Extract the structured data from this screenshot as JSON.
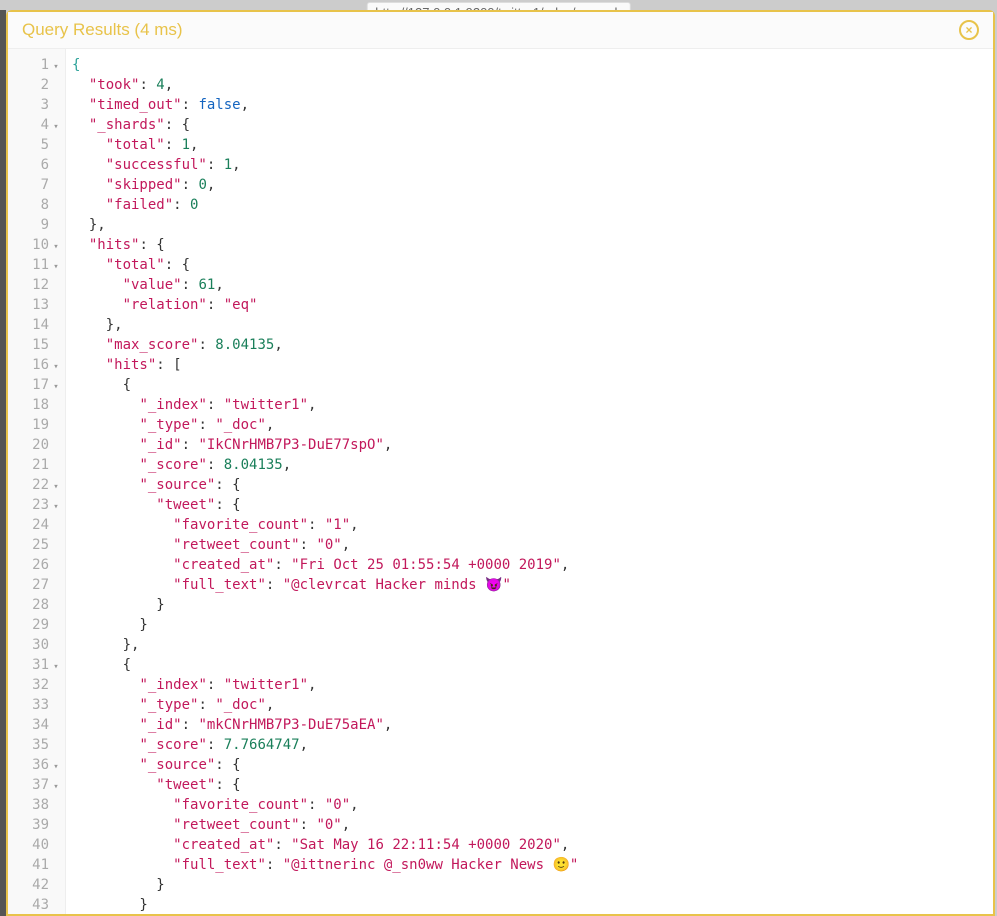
{
  "header": {
    "title": "Query Results (4 ms)",
    "close_label": "×",
    "background_url": "http://127.0.0.1:9200/twitter1/_doc/_search"
  },
  "code_lines": [
    {
      "num": 1,
      "fold": "▾",
      "tokens": [
        {
          "t": "{",
          "c": "br-open"
        }
      ]
    },
    {
      "num": 2,
      "fold": "",
      "tokens": [
        {
          "t": "  ",
          "c": "p"
        },
        {
          "t": "\"took\"",
          "c": "k"
        },
        {
          "t": ": ",
          "c": "p"
        },
        {
          "t": "4",
          "c": "n"
        },
        {
          "t": ",",
          "c": "p"
        }
      ]
    },
    {
      "num": 3,
      "fold": "",
      "tokens": [
        {
          "t": "  ",
          "c": "p"
        },
        {
          "t": "\"timed_out\"",
          "c": "k"
        },
        {
          "t": ": ",
          "c": "p"
        },
        {
          "t": "false",
          "c": "b"
        },
        {
          "t": ",",
          "c": "p"
        }
      ]
    },
    {
      "num": 4,
      "fold": "▾",
      "tokens": [
        {
          "t": "  ",
          "c": "p"
        },
        {
          "t": "\"_shards\"",
          "c": "k"
        },
        {
          "t": ": {",
          "c": "p"
        }
      ]
    },
    {
      "num": 5,
      "fold": "",
      "tokens": [
        {
          "t": "    ",
          "c": "p"
        },
        {
          "t": "\"total\"",
          "c": "k"
        },
        {
          "t": ": ",
          "c": "p"
        },
        {
          "t": "1",
          "c": "n"
        },
        {
          "t": ",",
          "c": "p"
        }
      ]
    },
    {
      "num": 6,
      "fold": "",
      "tokens": [
        {
          "t": "    ",
          "c": "p"
        },
        {
          "t": "\"successful\"",
          "c": "k"
        },
        {
          "t": ": ",
          "c": "p"
        },
        {
          "t": "1",
          "c": "n"
        },
        {
          "t": ",",
          "c": "p"
        }
      ]
    },
    {
      "num": 7,
      "fold": "",
      "tokens": [
        {
          "t": "    ",
          "c": "p"
        },
        {
          "t": "\"skipped\"",
          "c": "k"
        },
        {
          "t": ": ",
          "c": "p"
        },
        {
          "t": "0",
          "c": "n"
        },
        {
          "t": ",",
          "c": "p"
        }
      ]
    },
    {
      "num": 8,
      "fold": "",
      "tokens": [
        {
          "t": "    ",
          "c": "p"
        },
        {
          "t": "\"failed\"",
          "c": "k"
        },
        {
          "t": ": ",
          "c": "p"
        },
        {
          "t": "0",
          "c": "n"
        }
      ]
    },
    {
      "num": 9,
      "fold": "",
      "tokens": [
        {
          "t": "  },",
          "c": "p"
        }
      ]
    },
    {
      "num": 10,
      "fold": "▾",
      "tokens": [
        {
          "t": "  ",
          "c": "p"
        },
        {
          "t": "\"hits\"",
          "c": "k"
        },
        {
          "t": ": {",
          "c": "p"
        }
      ]
    },
    {
      "num": 11,
      "fold": "▾",
      "tokens": [
        {
          "t": "    ",
          "c": "p"
        },
        {
          "t": "\"total\"",
          "c": "k"
        },
        {
          "t": ": {",
          "c": "p"
        }
      ]
    },
    {
      "num": 12,
      "fold": "",
      "tokens": [
        {
          "t": "      ",
          "c": "p"
        },
        {
          "t": "\"value\"",
          "c": "k"
        },
        {
          "t": ": ",
          "c": "p"
        },
        {
          "t": "61",
          "c": "n"
        },
        {
          "t": ",",
          "c": "p"
        }
      ]
    },
    {
      "num": 13,
      "fold": "",
      "tokens": [
        {
          "t": "      ",
          "c": "p"
        },
        {
          "t": "\"relation\"",
          "c": "k"
        },
        {
          "t": ": ",
          "c": "p"
        },
        {
          "t": "\"eq\"",
          "c": "s"
        }
      ]
    },
    {
      "num": 14,
      "fold": "",
      "tokens": [
        {
          "t": "    },",
          "c": "p"
        }
      ]
    },
    {
      "num": 15,
      "fold": "",
      "tokens": [
        {
          "t": "    ",
          "c": "p"
        },
        {
          "t": "\"max_score\"",
          "c": "k"
        },
        {
          "t": ": ",
          "c": "p"
        },
        {
          "t": "8.04135",
          "c": "n"
        },
        {
          "t": ",",
          "c": "p"
        }
      ]
    },
    {
      "num": 16,
      "fold": "▾",
      "tokens": [
        {
          "t": "    ",
          "c": "p"
        },
        {
          "t": "\"hits\"",
          "c": "k"
        },
        {
          "t": ": [",
          "c": "p"
        }
      ]
    },
    {
      "num": 17,
      "fold": "▾",
      "tokens": [
        {
          "t": "      {",
          "c": "p"
        }
      ]
    },
    {
      "num": 18,
      "fold": "",
      "tokens": [
        {
          "t": "        ",
          "c": "p"
        },
        {
          "t": "\"_index\"",
          "c": "k"
        },
        {
          "t": ": ",
          "c": "p"
        },
        {
          "t": "\"twitter1\"",
          "c": "s"
        },
        {
          "t": ",",
          "c": "p"
        }
      ]
    },
    {
      "num": 19,
      "fold": "",
      "tokens": [
        {
          "t": "        ",
          "c": "p"
        },
        {
          "t": "\"_type\"",
          "c": "k"
        },
        {
          "t": ": ",
          "c": "p"
        },
        {
          "t": "\"_doc\"",
          "c": "s"
        },
        {
          "t": ",",
          "c": "p"
        }
      ]
    },
    {
      "num": 20,
      "fold": "",
      "tokens": [
        {
          "t": "        ",
          "c": "p"
        },
        {
          "t": "\"_id\"",
          "c": "k"
        },
        {
          "t": ": ",
          "c": "p"
        },
        {
          "t": "\"IkCNrHMB7P3-DuE77spO\"",
          "c": "s"
        },
        {
          "t": ",",
          "c": "p"
        }
      ]
    },
    {
      "num": 21,
      "fold": "",
      "tokens": [
        {
          "t": "        ",
          "c": "p"
        },
        {
          "t": "\"_score\"",
          "c": "k"
        },
        {
          "t": ": ",
          "c": "p"
        },
        {
          "t": "8.04135",
          "c": "n"
        },
        {
          "t": ",",
          "c": "p"
        }
      ]
    },
    {
      "num": 22,
      "fold": "▾",
      "tokens": [
        {
          "t": "        ",
          "c": "p"
        },
        {
          "t": "\"_source\"",
          "c": "k"
        },
        {
          "t": ": {",
          "c": "p"
        }
      ]
    },
    {
      "num": 23,
      "fold": "▾",
      "tokens": [
        {
          "t": "          ",
          "c": "p"
        },
        {
          "t": "\"tweet\"",
          "c": "k"
        },
        {
          "t": ": {",
          "c": "p"
        }
      ]
    },
    {
      "num": 24,
      "fold": "",
      "tokens": [
        {
          "t": "            ",
          "c": "p"
        },
        {
          "t": "\"favorite_count\"",
          "c": "k"
        },
        {
          "t": ": ",
          "c": "p"
        },
        {
          "t": "\"1\"",
          "c": "s"
        },
        {
          "t": ",",
          "c": "p"
        }
      ]
    },
    {
      "num": 25,
      "fold": "",
      "tokens": [
        {
          "t": "            ",
          "c": "p"
        },
        {
          "t": "\"retweet_count\"",
          "c": "k"
        },
        {
          "t": ": ",
          "c": "p"
        },
        {
          "t": "\"0\"",
          "c": "s"
        },
        {
          "t": ",",
          "c": "p"
        }
      ]
    },
    {
      "num": 26,
      "fold": "",
      "tokens": [
        {
          "t": "            ",
          "c": "p"
        },
        {
          "t": "\"created_at\"",
          "c": "k"
        },
        {
          "t": ": ",
          "c": "p"
        },
        {
          "t": "\"Fri Oct 25 01:55:54 +0000 2019\"",
          "c": "s"
        },
        {
          "t": ",",
          "c": "p"
        }
      ]
    },
    {
      "num": 27,
      "fold": "",
      "tokens": [
        {
          "t": "            ",
          "c": "p"
        },
        {
          "t": "\"full_text\"",
          "c": "k"
        },
        {
          "t": ": ",
          "c": "p"
        },
        {
          "t": "\"@clevrcat Hacker minds 😈\"",
          "c": "s"
        }
      ]
    },
    {
      "num": 28,
      "fold": "",
      "tokens": [
        {
          "t": "          }",
          "c": "p"
        }
      ]
    },
    {
      "num": 29,
      "fold": "",
      "tokens": [
        {
          "t": "        }",
          "c": "p"
        }
      ]
    },
    {
      "num": 30,
      "fold": "",
      "tokens": [
        {
          "t": "      },",
          "c": "p"
        }
      ]
    },
    {
      "num": 31,
      "fold": "▾",
      "tokens": [
        {
          "t": "      {",
          "c": "p"
        }
      ]
    },
    {
      "num": 32,
      "fold": "",
      "tokens": [
        {
          "t": "        ",
          "c": "p"
        },
        {
          "t": "\"_index\"",
          "c": "k"
        },
        {
          "t": ": ",
          "c": "p"
        },
        {
          "t": "\"twitter1\"",
          "c": "s"
        },
        {
          "t": ",",
          "c": "p"
        }
      ]
    },
    {
      "num": 33,
      "fold": "",
      "tokens": [
        {
          "t": "        ",
          "c": "p"
        },
        {
          "t": "\"_type\"",
          "c": "k"
        },
        {
          "t": ": ",
          "c": "p"
        },
        {
          "t": "\"_doc\"",
          "c": "s"
        },
        {
          "t": ",",
          "c": "p"
        }
      ]
    },
    {
      "num": 34,
      "fold": "",
      "tokens": [
        {
          "t": "        ",
          "c": "p"
        },
        {
          "t": "\"_id\"",
          "c": "k"
        },
        {
          "t": ": ",
          "c": "p"
        },
        {
          "t": "\"mkCNrHMB7P3-DuE75aEA\"",
          "c": "s"
        },
        {
          "t": ",",
          "c": "p"
        }
      ]
    },
    {
      "num": 35,
      "fold": "",
      "tokens": [
        {
          "t": "        ",
          "c": "p"
        },
        {
          "t": "\"_score\"",
          "c": "k"
        },
        {
          "t": ": ",
          "c": "p"
        },
        {
          "t": "7.7664747",
          "c": "n"
        },
        {
          "t": ",",
          "c": "p"
        }
      ]
    },
    {
      "num": 36,
      "fold": "▾",
      "tokens": [
        {
          "t": "        ",
          "c": "p"
        },
        {
          "t": "\"_source\"",
          "c": "k"
        },
        {
          "t": ": {",
          "c": "p"
        }
      ]
    },
    {
      "num": 37,
      "fold": "▾",
      "tokens": [
        {
          "t": "          ",
          "c": "p"
        },
        {
          "t": "\"tweet\"",
          "c": "k"
        },
        {
          "t": ": {",
          "c": "p"
        }
      ]
    },
    {
      "num": 38,
      "fold": "",
      "tokens": [
        {
          "t": "            ",
          "c": "p"
        },
        {
          "t": "\"favorite_count\"",
          "c": "k"
        },
        {
          "t": ": ",
          "c": "p"
        },
        {
          "t": "\"0\"",
          "c": "s"
        },
        {
          "t": ",",
          "c": "p"
        }
      ]
    },
    {
      "num": 39,
      "fold": "",
      "tokens": [
        {
          "t": "            ",
          "c": "p"
        },
        {
          "t": "\"retweet_count\"",
          "c": "k"
        },
        {
          "t": ": ",
          "c": "p"
        },
        {
          "t": "\"0\"",
          "c": "s"
        },
        {
          "t": ",",
          "c": "p"
        }
      ]
    },
    {
      "num": 40,
      "fold": "",
      "tokens": [
        {
          "t": "            ",
          "c": "p"
        },
        {
          "t": "\"created_at\"",
          "c": "k"
        },
        {
          "t": ": ",
          "c": "p"
        },
        {
          "t": "\"Sat May 16 22:11:54 +0000 2020\"",
          "c": "s"
        },
        {
          "t": ",",
          "c": "p"
        }
      ]
    },
    {
      "num": 41,
      "fold": "",
      "tokens": [
        {
          "t": "            ",
          "c": "p"
        },
        {
          "t": "\"full_text\"",
          "c": "k"
        },
        {
          "t": ": ",
          "c": "p"
        },
        {
          "t": "\"@ittnerinc @_sn0ww Hacker News 🙂\"",
          "c": "s"
        }
      ]
    },
    {
      "num": 42,
      "fold": "",
      "tokens": [
        {
          "t": "          }",
          "c": "p"
        }
      ]
    },
    {
      "num": 43,
      "fold": "",
      "tokens": [
        {
          "t": "        }",
          "c": "p"
        }
      ]
    }
  ]
}
